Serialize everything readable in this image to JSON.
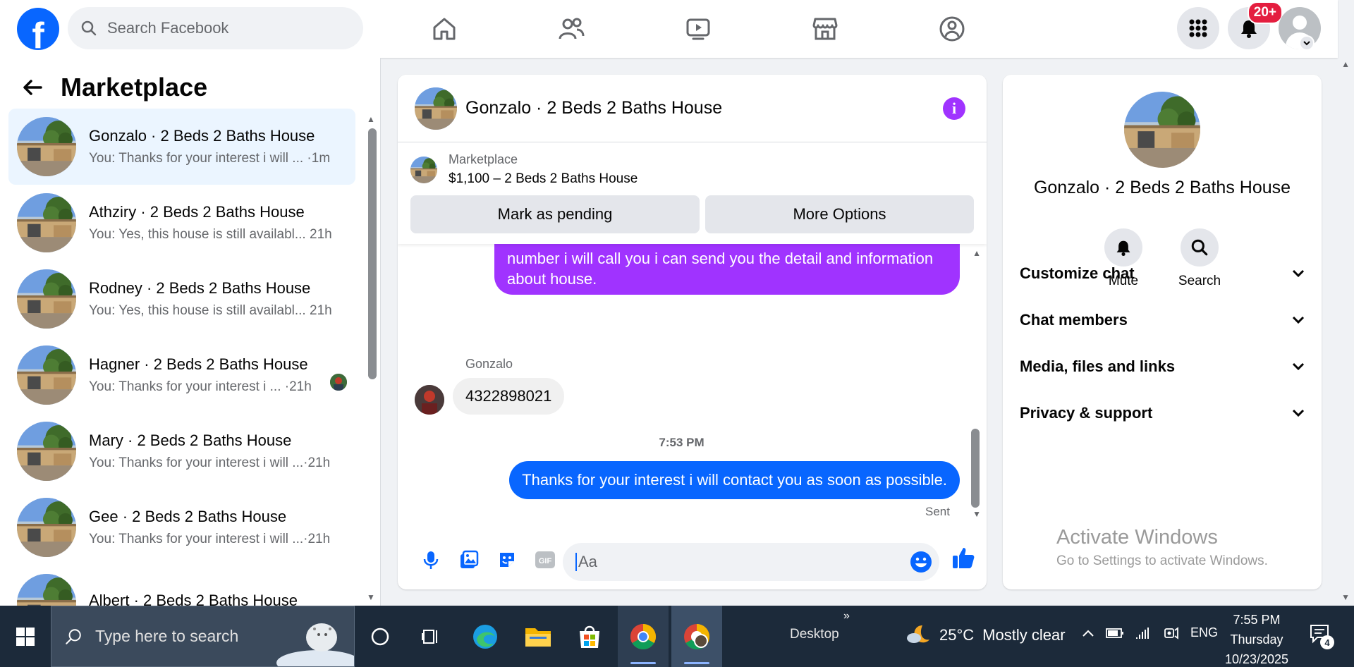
{
  "colors": {
    "brand": "#0866ff",
    "purple_bubble": "#a033ff",
    "badge_red": "#e41e3f",
    "active_conversation": "#ebf5ff"
  },
  "topbar": {
    "logo_letter": "f",
    "search_placeholder": "Search Facebook",
    "nav_icons": [
      "home-icon",
      "friends-icon",
      "video-icon",
      "marketplace-icon",
      "groups-icon"
    ],
    "notifications_badge": "20+"
  },
  "sidebar": {
    "title": "Marketplace",
    "conversations": [
      {
        "name": "Gonzalo · 2 Beds 2 Baths House",
        "preview": "You: Thanks for your interest i will ...",
        "time": "·1m",
        "active": true
      },
      {
        "name": "Athziry · 2 Beds 2 Baths House",
        "preview": "You: Yes, this house is still availabl...",
        "time": "21h"
      },
      {
        "name": "Rodney · 2 Beds 2 Baths House",
        "preview": "You: Yes, this house is still availabl...",
        "time": "21h"
      },
      {
        "name": "Hagner · 2 Beds 2 Baths House",
        "preview": "You: Thanks for your interest i ...",
        "time": "·21h"
      },
      {
        "name": "Mary · 2 Beds 2 Baths House",
        "preview": "You: Thanks for your interest i will ...",
        "time": "·21h"
      },
      {
        "name": "Gee · 2 Beds 2 Baths House",
        "preview": "You: Thanks for your interest i will ...",
        "time": "·21h"
      },
      {
        "name": "Albert · 2 Beds 2 Baths House",
        "preview": "",
        "time": ""
      }
    ]
  },
  "chat": {
    "title": "Gonzalo · 2 Beds 2 Baths House",
    "listing_source": "Marketplace",
    "listing_price": "$1,100 – 2 Beds 2 Baths House",
    "mark_pending_label": "Mark as pending",
    "more_options_label": "More Options",
    "outgoing_message_1": "number i will call you i can send you the detail and information about house.",
    "sender_name": "Gonzalo",
    "incoming_message": "4322898021",
    "timestamp": "7:53 PM",
    "outgoing_message_2": "Thanks for your interest i will contact you as soon as possible.",
    "status": "Sent",
    "composer_placeholder": "Aa"
  },
  "info_panel": {
    "title": "Gonzalo · 2 Beds 2 Baths House",
    "mute_label": "Mute",
    "search_label": "Search",
    "sections": [
      "Customize chat",
      "Chat members",
      "Media, files and links",
      "Privacy & support"
    ],
    "activate_title": "Activate Windows",
    "activate_sub": "Go to Settings to activate Windows."
  },
  "taskbar": {
    "search_placeholder": "Type here to search",
    "desktop_label": "Desktop",
    "weather_temp": "25°C",
    "weather_desc": "Mostly clear",
    "language": "ENG",
    "time": "7:55 PM",
    "day": "Thursday",
    "date": "10/23/2025",
    "notification_count": "4"
  }
}
